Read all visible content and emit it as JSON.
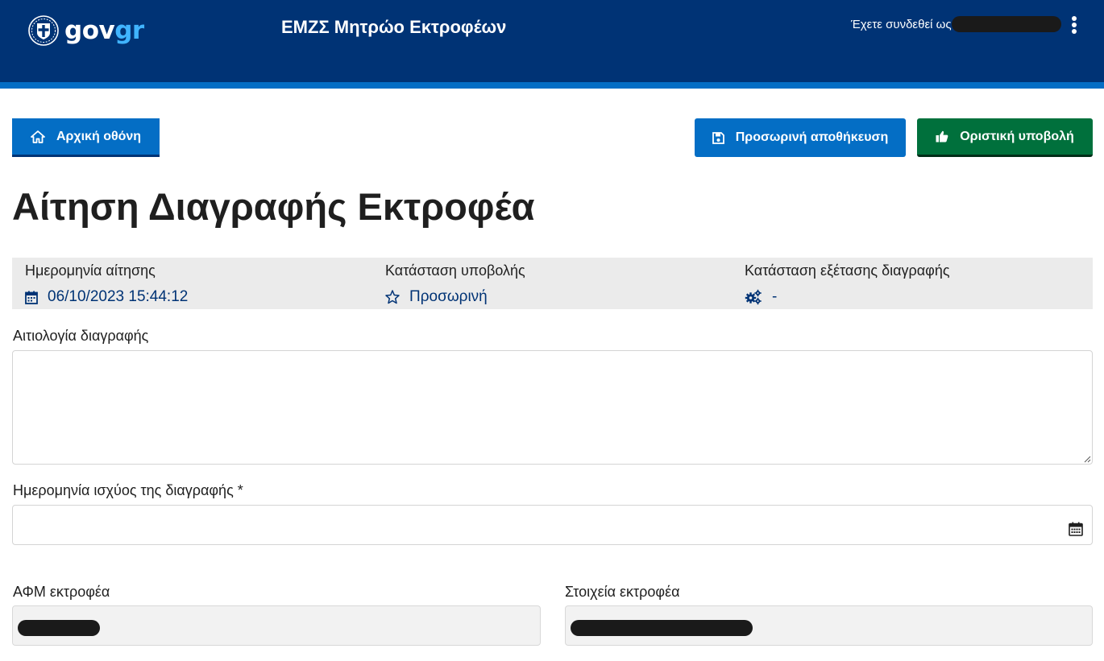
{
  "header": {
    "logo_gov": "gov",
    "logo_gr": "gr",
    "app_title": "ΕΜΖΣ Μητρώο Εκτροφέων",
    "user_prefix": "Έχετε συνδεθεί ως"
  },
  "toolbar": {
    "home_label": "Αρχική οθόνη",
    "save_label": "Προσωρινή αποθήκευση",
    "submit_label": "Οριστική υποβολή"
  },
  "page": {
    "title": "Αίτηση Διαγραφής Εκτροφέα"
  },
  "summary": {
    "date_label": "Ημερομηνία αίτησης",
    "date_value": "06/10/2023 15:44:12",
    "status_label": "Κατάσταση υποβολής",
    "status_value": "Προσωρινή",
    "review_label": "Κατάσταση εξέτασης διαγραφής",
    "review_value": "-"
  },
  "form": {
    "reason_label": "Αιτιολογία διαγραφής",
    "reason_value": "",
    "effective_date_label": "Ημερομηνία ισχύος της διαγραφής *",
    "effective_date_value": "",
    "afm_label": "ΑΦΜ εκτροφέα",
    "details_label": "Στοιχεία εκτροφέα"
  },
  "colors": {
    "header_bg": "#003375",
    "header_stripe": "#046ec5",
    "primary_button": "#046ec5",
    "submit_button": "#00703c",
    "summary_bg": "#ebebeb",
    "summary_value": "#003375"
  },
  "icons": {
    "home": "home-icon",
    "save": "floppy-disk-icon",
    "submit": "thumbs-up-icon",
    "date": "calendar-icon",
    "status": "star-outline-icon",
    "review": "gears-icon",
    "menu": "kebab-menu-icon"
  }
}
